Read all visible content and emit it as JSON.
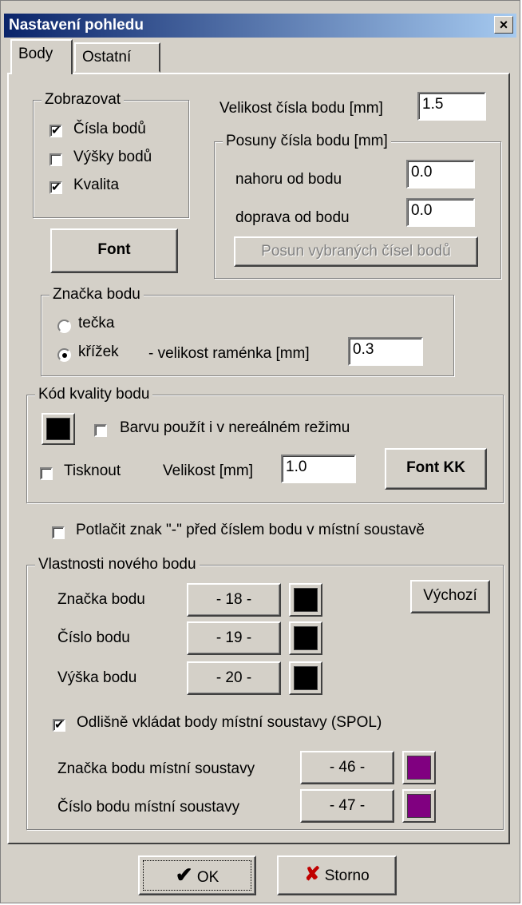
{
  "window": {
    "title": "Nastavení pohledu",
    "close_glyph": "×"
  },
  "tabs": [
    {
      "label": "Body",
      "active": true
    },
    {
      "label": "Ostatní",
      "active": false
    }
  ],
  "display_group": {
    "title": "Zobrazovat",
    "items": [
      {
        "label": "Čísla bodů",
        "checked": true
      },
      {
        "label": "Výšky bodů",
        "checked": false
      },
      {
        "label": "Kvalita",
        "checked": true
      }
    ]
  },
  "font_button": "Font",
  "number_size": {
    "label": "Velikost čísla bodu [mm]",
    "value": "1.5"
  },
  "offset_group": {
    "title": "Posuny čísla bodu [mm]",
    "up_label": "nahoru od bodu",
    "up_value": "0.0",
    "right_label": "doprava od bodu",
    "right_value": "0.0",
    "move_button": "Posun vybraných čísel bodů"
  },
  "mark_group": {
    "title": "Značka bodu",
    "dot_label": "tečka",
    "cross_label": "křížek",
    "arm_label": "- velikost raménka [mm]",
    "arm_value": "0.3",
    "selected": "cross"
  },
  "quality_group": {
    "title": "Kód kvality bodu",
    "color": "#000000",
    "nonreal_label": "Barvu použít i v nereálném režimu",
    "nonreal_checked": false,
    "print_label": "Tisknout",
    "print_checked": false,
    "size_label": "Velikost  [mm]",
    "size_value": "1.0",
    "font_button": "Font KK"
  },
  "suppress": {
    "label": "Potlačit znak \"-\" před číslem bodu v místní soustavě",
    "checked": false
  },
  "new_point_group": {
    "title": "Vlastnosti nového bodu",
    "default_button": "Výchozí",
    "rows": [
      {
        "label": "Značka bodu",
        "value": "- 18 -",
        "color": "#000000"
      },
      {
        "label": "Číslo bodu",
        "value": "- 19 -",
        "color": "#000000"
      },
      {
        "label": "Výška bodu",
        "value": "- 20 -",
        "color": "#000000"
      }
    ],
    "spol_label": "Odlišně vkládat body místní soustavy  (SPOL)",
    "spol_checked": true,
    "local_rows": [
      {
        "label": "Značka bodu místní soustavy",
        "value": "- 46 -",
        "color": "#800080"
      },
      {
        "label": "Číslo bodu místní soustavy",
        "value": "- 47 -",
        "color": "#800080"
      }
    ]
  },
  "footer": {
    "ok_label": "OK",
    "cancel_label": "Storno",
    "ok_icon": "✔",
    "cancel_icon": "✘",
    "ok_color": "#000000",
    "cancel_color": "#c00000"
  }
}
